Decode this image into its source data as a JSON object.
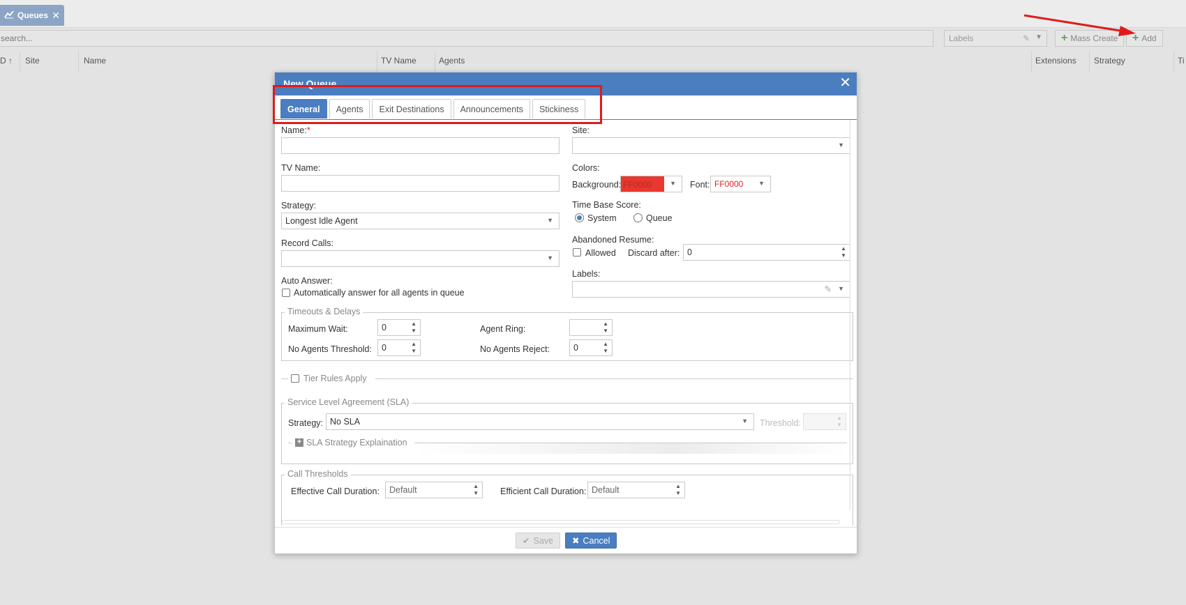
{
  "app": {
    "tab_label": "Queues",
    "search_placeholder": "search...",
    "labels_placeholder": "Labels",
    "mass_create_label": "Mass Create",
    "add_label": "Add",
    "columns": [
      "D ↑",
      "Site",
      "Name",
      "TV Name",
      "Agents",
      "Extensions",
      "Strategy",
      "Ti"
    ]
  },
  "dialog": {
    "title": "New Queue",
    "tabs": [
      "General",
      "Agents",
      "Exit Destinations",
      "Announcements",
      "Stickiness"
    ],
    "active_tab": "General",
    "fields": {
      "name_label": "Name:",
      "required_mark": "*",
      "tv_name_label": "TV Name:",
      "strategy_label": "Strategy:",
      "strategy_value": "Longest Idle Agent",
      "record_calls_label": "Record Calls:",
      "auto_answer_label": "Auto Answer:",
      "auto_answer_checkbox": "Automatically answer for all agents in queue",
      "site_label": "Site:",
      "colors_label": "Colors:",
      "background_label": "Background:",
      "background_value": "FF0000",
      "font_label": "Font:",
      "font_value": "FF0000",
      "time_base_label": "Time Base Score:",
      "time_base_system": "System",
      "time_base_queue": "Queue",
      "abandoned_label": "Abandoned Resume:",
      "allowed_label": "Allowed",
      "discard_label": "Discard after:",
      "discard_value": "0",
      "labels_label": "Labels:"
    },
    "timeouts": {
      "legend": "Timeouts & Delays",
      "max_wait_label": "Maximum Wait:",
      "max_wait_value": "0",
      "no_agents_threshold_label": "No Agents Threshold:",
      "no_agents_threshold_value": "0",
      "agent_ring_label": "Agent Ring:",
      "agent_ring_value": "",
      "no_agents_reject_label": "No Agents Reject:",
      "no_agents_reject_value": "0"
    },
    "tier_rules_label": "Tier Rules Apply",
    "sla": {
      "legend": "Service Level Agreement (SLA)",
      "strategy_label": "Strategy:",
      "strategy_value": "No SLA",
      "threshold_label": "Threshold:",
      "explanation_label": "SLA Strategy Explaination"
    },
    "call_thresholds": {
      "legend": "Call Thresholds",
      "effective_label": "Effective Call Duration:",
      "effective_value": "Default",
      "efficient_label": "Efficient Call Duration:",
      "efficient_value": "Default"
    },
    "save_label": "Save",
    "cancel_label": "Cancel"
  },
  "colors": {
    "accent": "#4a7ec0",
    "annotation": "#e01b1b",
    "swatch": "#e8382f"
  }
}
